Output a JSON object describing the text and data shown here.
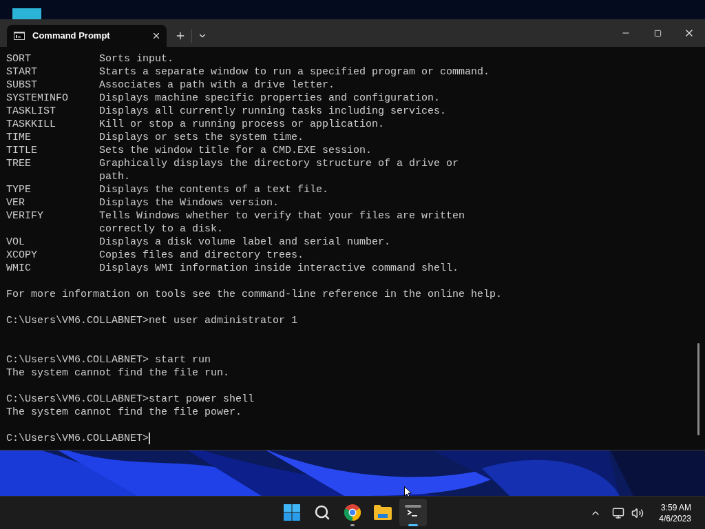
{
  "window": {
    "tabs": [
      {
        "title": "Command Prompt",
        "selected": true
      }
    ],
    "lines": [
      {
        "kind": "command",
        "name": "SORT",
        "description": "Sorts input."
      },
      {
        "kind": "command",
        "name": "START",
        "description": "Starts a separate window to run a specified program or command."
      },
      {
        "kind": "command",
        "name": "SUBST",
        "description": "Associates a path with a drive letter."
      },
      {
        "kind": "command",
        "name": "SYSTEMINFO",
        "description": "Displays machine specific properties and configuration."
      },
      {
        "kind": "command",
        "name": "TASKLIST",
        "description": "Displays all currently running tasks including services."
      },
      {
        "kind": "command",
        "name": "TASKKILL",
        "description": "Kill or stop a running process or application."
      },
      {
        "kind": "command",
        "name": "TIME",
        "description": "Displays or sets the system time."
      },
      {
        "kind": "command",
        "name": "TITLE",
        "description": "Sets the window title for a CMD.EXE session."
      },
      {
        "kind": "command",
        "name": "TREE",
        "description": "Graphically displays the directory structure of a drive or"
      },
      {
        "kind": "continuation",
        "description": "path."
      },
      {
        "kind": "command",
        "name": "TYPE",
        "description": "Displays the contents of a text file."
      },
      {
        "kind": "command",
        "name": "VER",
        "description": "Displays the Windows version."
      },
      {
        "kind": "command",
        "name": "VERIFY",
        "description": "Tells Windows whether to verify that your files are written"
      },
      {
        "kind": "continuation",
        "description": "correctly to a disk."
      },
      {
        "kind": "command",
        "name": "VOL",
        "description": "Displays a disk volume label and serial number."
      },
      {
        "kind": "command",
        "name": "XCOPY",
        "description": "Copies files and directory trees."
      },
      {
        "kind": "command",
        "name": "WMIC",
        "description": "Displays WMI information inside interactive command shell."
      },
      {
        "kind": "blank"
      },
      {
        "kind": "text",
        "text": "For more information on tools see the command-line reference in the online help."
      },
      {
        "kind": "blank"
      },
      {
        "kind": "text",
        "text": "C:\\Users\\VM6.COLLABNET>net user administrator 1"
      },
      {
        "kind": "blank"
      },
      {
        "kind": "blank"
      },
      {
        "kind": "text",
        "text": "C:\\Users\\VM6.COLLABNET> start run"
      },
      {
        "kind": "text",
        "text": "The system cannot find the file run."
      },
      {
        "kind": "blank"
      },
      {
        "kind": "text",
        "text": "C:\\Users\\VM6.COLLABNET>start power shell"
      },
      {
        "kind": "text",
        "text": "The system cannot find the file power."
      },
      {
        "kind": "blank"
      },
      {
        "kind": "prompt",
        "text": "C:\\Users\\VM6.COLLABNET>"
      }
    ]
  },
  "taskbar": {
    "apps": [
      {
        "kind": "start",
        "running": false,
        "selected": false
      },
      {
        "kind": "search",
        "running": false,
        "selected": false
      },
      {
        "kind": "browser",
        "running": true,
        "selected": false
      },
      {
        "kind": "folder",
        "running": false,
        "selected": false
      },
      {
        "kind": "terminal",
        "running": true,
        "selected": true
      }
    ],
    "clock": {
      "time": "3:59 AM",
      "date": "4/6/2023"
    }
  }
}
